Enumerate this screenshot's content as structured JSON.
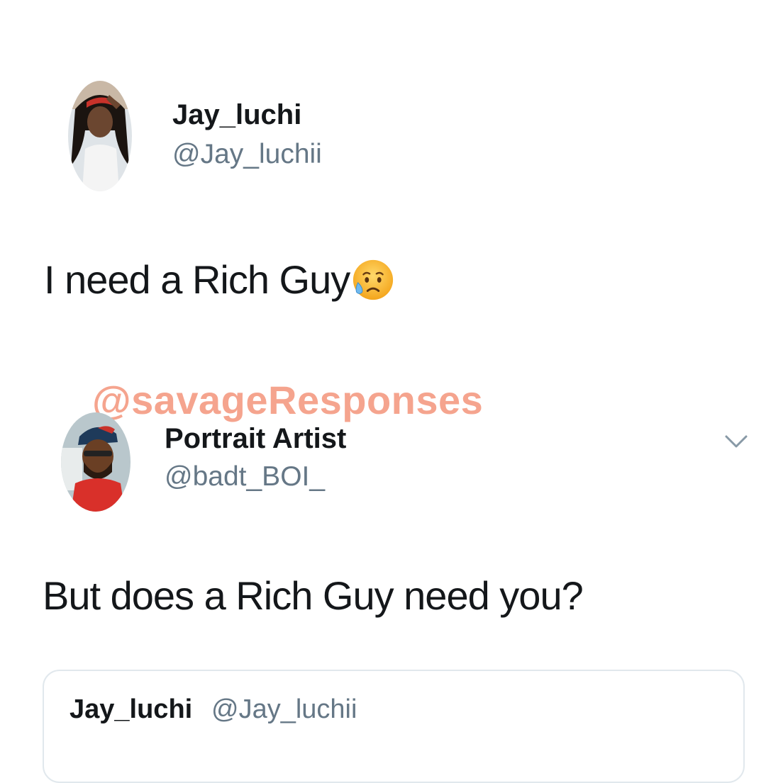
{
  "original_tweet": {
    "display_name": "Jay_luchi",
    "handle": "@Jay_luchii",
    "text": "I need a Rich Guy",
    "emoji": "sad-but-relieved-face-emoji"
  },
  "watermark": "@savageResponses",
  "reply_tweet": {
    "display_name": "Portrait Artist",
    "handle": "@badt_BOI_",
    "text": "But does a Rich Guy need you?",
    "menu_icon": "chevron-down-icon"
  },
  "quoted_tweet": {
    "display_name": "Jay_luchi",
    "handle": "@Jay_luchii"
  },
  "colors": {
    "text": "#14171a",
    "handle": "#657786",
    "watermark": "#f5a48e",
    "card_border": "#e1e8ed"
  }
}
